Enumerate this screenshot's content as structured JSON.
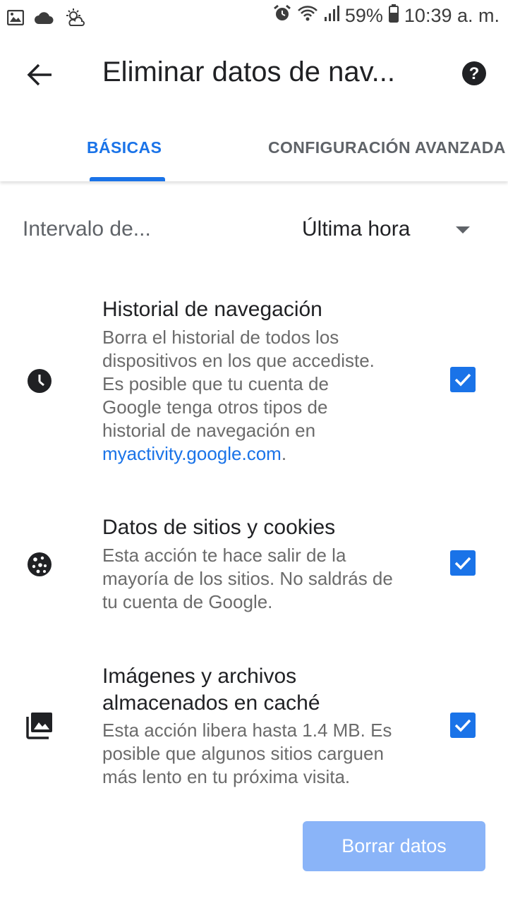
{
  "status_bar": {
    "battery": "59%",
    "time": "10:39 a. m.",
    "icons": [
      "image-icon",
      "cloud-icon",
      "weather-icon",
      "alarm-icon",
      "wifi-icon",
      "signal-icon",
      "battery-icon"
    ]
  },
  "app_bar": {
    "title": "Eliminar datos de nav...",
    "back_icon": "arrow-back-icon",
    "help_icon": "help-icon"
  },
  "tabs": [
    {
      "label": "BÁSICAS",
      "active": true
    },
    {
      "label": "CONFIGURACIÓN AVANZADA",
      "active": false
    }
  ],
  "range": {
    "label": "Intervalo de...",
    "value": "Última hora"
  },
  "items": [
    {
      "icon": "clock-icon",
      "title": "Historial de navegación",
      "desc_lines": [
        "Borra el historial de todos los",
        "dispositivos en los que accediste.",
        "Es posible que tu cuenta de",
        "Google tenga otros tipos de",
        "historial de navegación en"
      ],
      "link": "myactivity.google.com",
      "link_suffix": ".",
      "checked": true
    },
    {
      "icon": "cookie-icon",
      "title": "Datos de sitios y cookies",
      "desc_lines": [
        "Esta acción te hace salir de la",
        "mayoría de los sitios. No saldrás de",
        "tu cuenta de Google."
      ],
      "checked": true
    },
    {
      "icon": "images-icon",
      "title_lines": [
        "Imágenes y archivos",
        "almacenados en caché"
      ],
      "desc_lines": [
        "Esta acción libera hasta 1.4 MB. Es",
        "posible que algunos sitios carguen",
        "más lento en tu próxima visita."
      ],
      "checked": true
    }
  ],
  "clear_button": "Borrar datos",
  "colors": {
    "accent": "#1a73e8",
    "button_disabled": "#8ab4f8"
  }
}
